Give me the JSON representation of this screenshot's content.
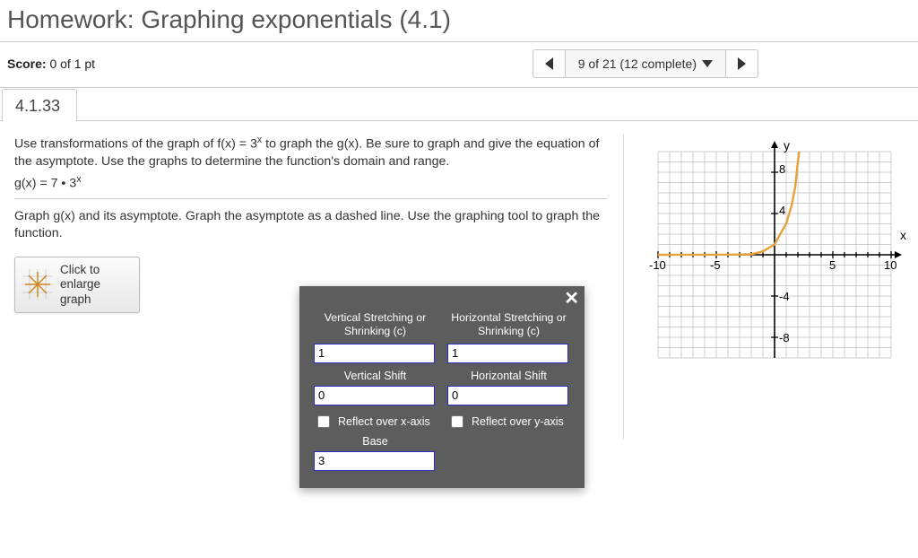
{
  "page_title": "Homework: Graphing exponentials (4.1)",
  "score": {
    "label": "Score:",
    "value": "0 of 1 pt"
  },
  "progress": {
    "text": "9 of 21 (12 complete)"
  },
  "question_number": "4.1.33",
  "problem": {
    "line1": "Use transformations of the graph of f(x) = 3",
    "line1_after_sup": " to graph the g(x). Be sure to graph and give the equation of the asymptote. Use the graphs to determine the function's domain and range.",
    "equation_prefix": "g(x) = 7 • 3",
    "instruction": "Graph g(x) and its asymptote. Graph the asymptote as a dashed line. Use the graphing tool to graph the function."
  },
  "enlarge": {
    "line1": "Click to",
    "line2": "enlarge",
    "line3": "graph"
  },
  "panel": {
    "vertical_stretch_label": "Vertical Stretching or Shrinking (c)",
    "horizontal_stretch_label": "Horizontal Stretching or Shrinking (c)",
    "vertical_stretch_value": "1",
    "horizontal_stretch_value": "1",
    "vertical_shift_label": "Vertical Shift",
    "horizontal_shift_label": "Horizontal Shift",
    "vertical_shift_value": "0",
    "horizontal_shift_value": "0",
    "reflect_x_label": "Reflect over x-axis",
    "reflect_y_label": "Reflect over y-axis",
    "base_label": "Base",
    "base_value": "3"
  },
  "graph": {
    "y_label": "y",
    "x_label": "x",
    "x_ticks": [
      "-10",
      "-5",
      "5",
      "10"
    ],
    "y_ticks": [
      "8",
      "4",
      "-4",
      "-8"
    ]
  },
  "chart_data": {
    "type": "line",
    "title": "",
    "xlabel": "x",
    "ylabel": "y",
    "xlim": [
      -10,
      10
    ],
    "ylim": [
      -10,
      10
    ],
    "series": [
      {
        "name": "f(x)=3^x",
        "x": [
          -10,
          -5,
          -2,
          -1,
          0,
          1,
          1.5,
          2
        ],
        "y": [
          0,
          0.004,
          0.111,
          0.333,
          1,
          3,
          5.196,
          9
        ]
      }
    ],
    "asymptote": {
      "y": 0
    }
  }
}
